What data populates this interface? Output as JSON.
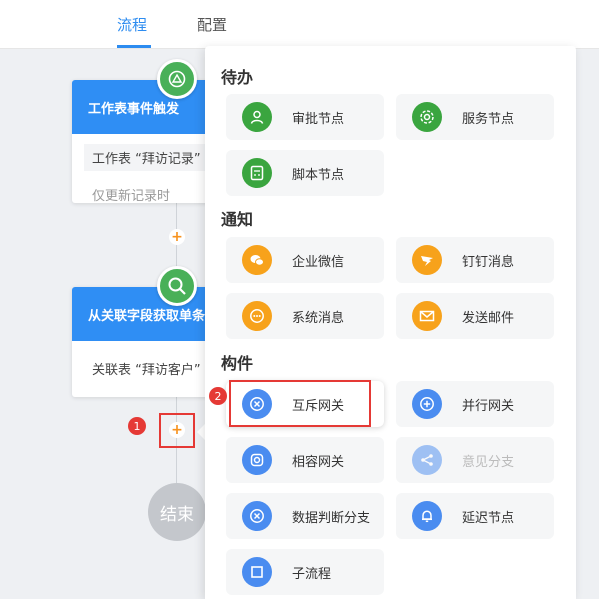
{
  "tabs": [
    {
      "label": "流程",
      "active": true
    },
    {
      "label": "配置",
      "active": false
    }
  ],
  "flow": {
    "card1": {
      "title": "工作表事件触发",
      "line1": "工作表 “拜访记录”",
      "line2": "仅更新记录时"
    },
    "card2": {
      "title": "从关联字段获取单条",
      "line1": "关联表 “拜访客户”"
    },
    "plus": "+",
    "end": "结束",
    "badge1": "1",
    "badge2": "2"
  },
  "panel": {
    "sections": [
      {
        "title": "待办",
        "items": [
          "审批节点",
          "服务节点",
          "脚本节点"
        ]
      },
      {
        "title": "通知",
        "items": [
          "企业微信",
          "钉钉消息",
          "系统消息",
          "发送邮件"
        ]
      },
      {
        "title": "构件",
        "items": [
          "互斥网关",
          "并行网关",
          "相容网关",
          "意见分支",
          "数据判断分支",
          "延迟节点",
          "子流程"
        ]
      }
    ]
  },
  "colors": {
    "accent": "#2d8cf0",
    "green": "#3aa53f",
    "orange": "#f7a21b",
    "blue_icon": "#4a8cf0",
    "red_highlight": "#e53935"
  }
}
